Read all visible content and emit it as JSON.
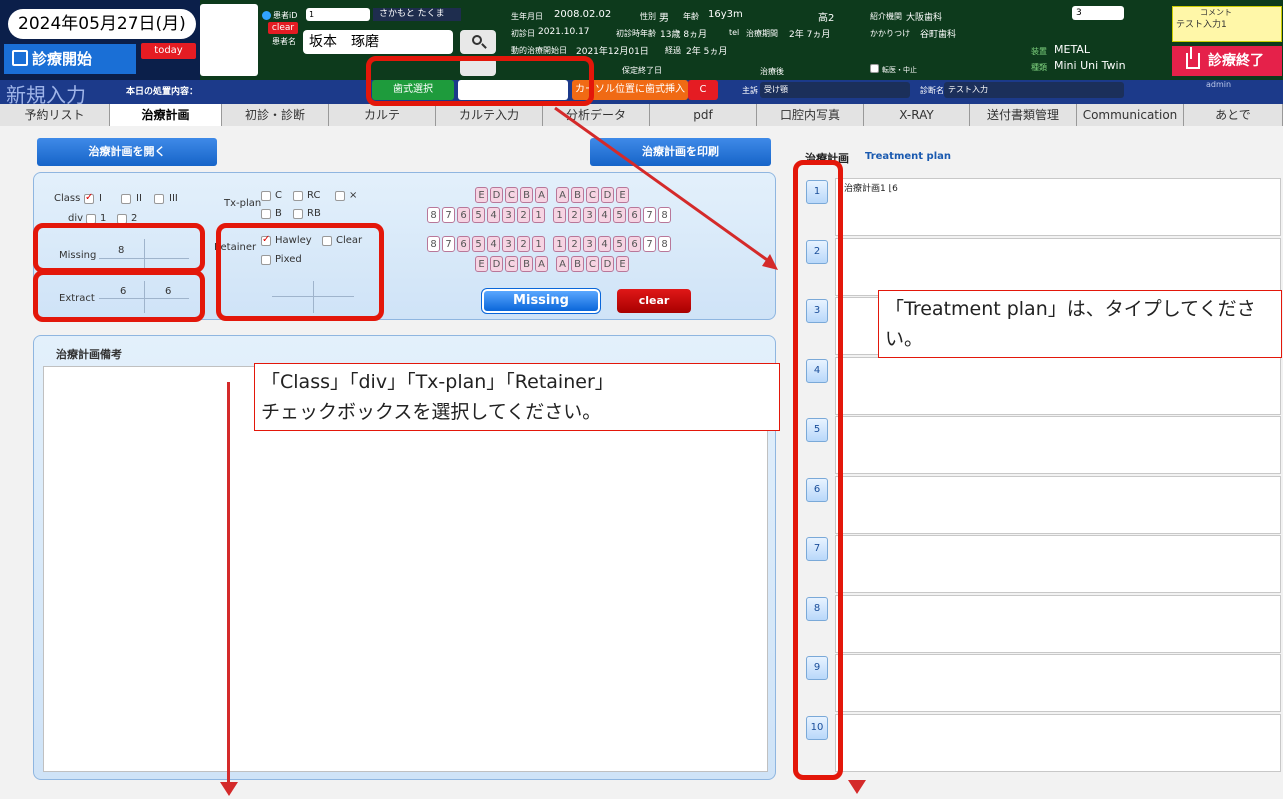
{
  "header": {
    "date": "2024年05月27日(月)",
    "start_label": "診療開始",
    "today_label": "today",
    "patient_id_label": "患者iD",
    "patient_id_value": "1",
    "patient_kana": "さかもと たくま",
    "clear_label": "clear",
    "patient_name_label": "患者名",
    "patient_name": "坂本　琢磨",
    "birth_label": "生年月日",
    "birth_value": "2008.02.02",
    "sex_label": "性別",
    "sex_value": "男",
    "age_label": "年齢",
    "age_value": "16y3m",
    "grade_value": "高2",
    "first_visit_label": "初診日",
    "first_visit_value": "2021.10.17",
    "first_age_label": "初診時年齢",
    "first_age_value": "13歳 8ヵ月",
    "tel_label": "tel",
    "treatment_period_label": "治療期間",
    "treatment_period_value": "2年 7ヵ月",
    "active_start_label": "動的治療開始日",
    "active_start_value": "2021年12月01日",
    "elapsed_label": "経過",
    "elapsed_value": "2年 5ヵ月",
    "retention_end_label": "保定終了日",
    "after_treatment_label": "治療後",
    "transfer_label": "転医・中止",
    "referral_label": "紹介機関",
    "referral_value": "大阪歯科",
    "family_label": "かかりつけ",
    "family_value": "谷町歯科",
    "device_label": "装置",
    "device_value": "METAL",
    "type_label": "種類",
    "type_value": "Mini Uni Twin",
    "select_value": "3",
    "comment_label": "コメント",
    "comment_value": "テスト入力1",
    "end_label": "診療終了",
    "admin": "admin"
  },
  "subbar": {
    "title": "新規入力",
    "today_content_label": "本日の処置内容：",
    "tooth_select_label": "歯式選択",
    "cursor_insert_label": "カーソル位置に歯式挿入",
    "c_label": "C",
    "complaint_label": "主訴",
    "complaint_value": "受け顎",
    "diagnosis_label": "診断名",
    "diagnosis_value": "テスト入力"
  },
  "tabs": [
    "予約リスト",
    "治療計画",
    "初診・診断",
    "カルテ",
    "カルテ入力",
    "分析データ",
    "pdf",
    "口腔内写真",
    "X-RAY",
    "送付書類管理",
    "Communication",
    "あとで"
  ],
  "left": {
    "open_plan_label": "治療計画を開く",
    "print_plan_label": "治療計画を印刷",
    "class_label": "Class",
    "class_options": [
      "I",
      "II",
      "III"
    ],
    "div_label": "div",
    "div_options": [
      "1",
      "2"
    ],
    "txplan_label": "Tx-plan",
    "txplan_options": [
      "C",
      "RC",
      "×",
      "B",
      "RB"
    ],
    "retainer_label": "Retainer",
    "retainer_options": [
      "Hawley",
      "Clear",
      "Pixed"
    ],
    "missing_label": "Missing",
    "missing_value": "8",
    "extract_label": "Extract",
    "extract_left": "6",
    "extract_right": "6",
    "deciduous_upper": [
      "E",
      "D",
      "C",
      "B",
      "A",
      "A",
      "B",
      "C",
      "D",
      "E"
    ],
    "perm_upper": [
      "8",
      "7",
      "6",
      "5",
      "4",
      "3",
      "2",
      "1",
      "1",
      "2",
      "3",
      "4",
      "5",
      "6",
      "7",
      "8"
    ],
    "perm_lower": [
      "8",
      "7",
      "6",
      "5",
      "4",
      "3",
      "2",
      "1",
      "1",
      "2",
      "3",
      "4",
      "5",
      "6",
      "7",
      "8"
    ],
    "deciduous_lower": [
      "E",
      "D",
      "C",
      "B",
      "A",
      "A",
      "B",
      "C",
      "D",
      "E"
    ],
    "missing_btn_label": "Missing",
    "clear_btn_label": "clear",
    "notes_title": "治療計画備考"
  },
  "right": {
    "title": "治療計画",
    "subtitle": "Treatment plan",
    "numbers": [
      "1",
      "2",
      "3",
      "4",
      "5",
      "6",
      "7",
      "8",
      "9",
      "10"
    ],
    "row1_text": "治療計画1 ⌊6"
  },
  "annotations": {
    "callout_right": "「Treatment plan」は、タイプしてください。",
    "callout_left_line1": "「Class」「div」「Tx-plan」「Retainer」",
    "callout_left_line2": "チェックボックスを選択してください。"
  }
}
